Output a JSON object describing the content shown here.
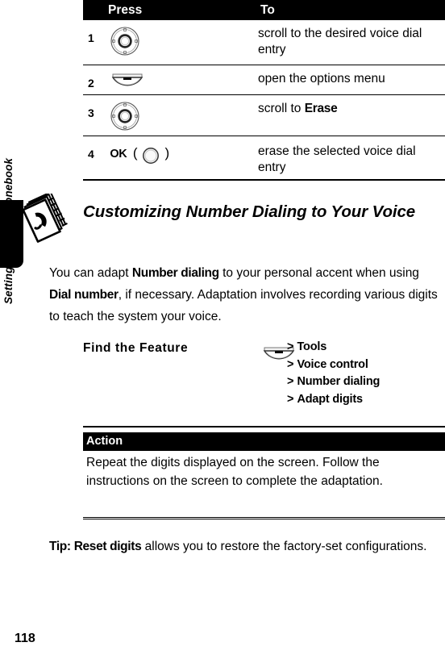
{
  "chapter": {
    "tab_title": "Setting Up Your Phonebook",
    "icon": "phonebook-icon"
  },
  "press_table": {
    "header": {
      "press": "Press",
      "to": "To"
    },
    "rows": [
      {
        "num": "1",
        "key_icon": "nav-key-icon",
        "key_label": "",
        "to_pre": "scroll to the desired voice dial entry",
        "to_bold": "",
        "to_post": ""
      },
      {
        "num": "2",
        "key_icon": "menu-key-icon",
        "key_label": "",
        "to_pre": "open the options menu",
        "to_bold": "",
        "to_post": ""
      },
      {
        "num": "3",
        "key_icon": "nav-key-icon",
        "key_label": "",
        "to_pre": "scroll to ",
        "to_bold": "Erase",
        "to_post": ""
      },
      {
        "num": "4",
        "key_icon": "ok-key-icon",
        "key_label": "OK",
        "to_pre": "erase the selected voice dial entry",
        "to_bold": "",
        "to_post": ""
      }
    ]
  },
  "section": {
    "heading": "Customizing Number Dialing to Your Voice",
    "paragraph_p1": "You can adapt ",
    "paragraph_b1": "Number dialing",
    "paragraph_p2": " to your personal accent when using ",
    "paragraph_b2": "Dial number",
    "paragraph_p3": ", if necessary. Adaptation involves recording various digits to teach the system your voice."
  },
  "find_the_feature": {
    "label": "Find the Feature",
    "icon": "menu-key-icon",
    "separator": ">",
    "path": [
      "Tools",
      "Voice control",
      "Number dialing",
      "Adapt digits"
    ]
  },
  "action": {
    "header": "Action",
    "text": "Repeat the digits displayed on the screen. Follow the instructions on the screen to complete the adaptation."
  },
  "tip": {
    "prefix": "Tip: ",
    "bold": "Reset digits",
    "text": " allows you to restore the factory-set configurations."
  },
  "footer": {
    "page_number": "118"
  },
  "colors": {
    "ink": "#000000",
    "paper": "#ffffff",
    "header_bg": "#000000",
    "header_fg": "#ffffff"
  }
}
